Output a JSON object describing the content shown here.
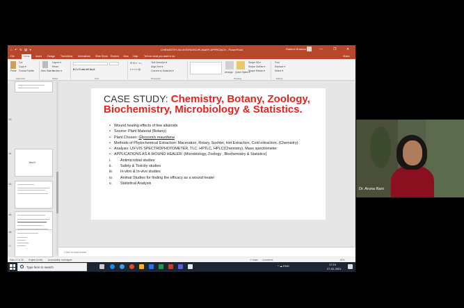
{
  "titlebar": {
    "quick_access": "⌂ ↶ ↻ ▤ ▾",
    "document_title": "CHEMISTRY AN INTERDISCIPLINARY APPROACH - PowerPoint",
    "user": "Rashmi Sharma",
    "minimize": "—",
    "restore": "❐",
    "close": "✕"
  },
  "menu": {
    "file": "File",
    "home": "Home",
    "insert": "Insert",
    "design": "Design",
    "transitions": "Transitions",
    "animations": "Animations",
    "slide_show": "Slide Show",
    "review": "Review",
    "view": "View",
    "help": "Help",
    "tell_me": "Tell me what you want to do",
    "share": "Share"
  },
  "ribbon": {
    "paste": "Paste",
    "cut": "Cut",
    "copy": "Copy ▾",
    "format_painter": "Format Painter",
    "clipboard": "Clipboard",
    "new_slide": "New Slide ▾",
    "layout": "Layout ▾",
    "reset": "Reset",
    "section": "Section ▾",
    "slides": "Slides",
    "font": "Font",
    "paragraph": "Paragraph",
    "text_direction": "Text Direction ▾",
    "align_text": "Align Text ▾",
    "convert_smartart": "Convert to SmartArt ▾",
    "arrange": "Arrange",
    "quick_styles": "Quick Styles ▾",
    "shape_fill": "Shape Fill ▾",
    "shape_outline": "Shape Outline ▾",
    "shape_effects": "Shape Effects ▾",
    "drawing": "Drawing",
    "find": "Find",
    "replace": "Replace ▾",
    "select": "Select ▾",
    "editing": "Editing"
  },
  "thumbnails": {
    "slide13_num": "13",
    "slide14_num": "14",
    "slide14_text": "Yes!!!",
    "slide15_num": "15",
    "slide16_num": "16",
    "slide17_num": "17",
    "slide18_num": "18"
  },
  "slide": {
    "title_prefix": "CASE STUDY:",
    "title_main": "Chemistry, Botany, Zoology, Biochemistry, Microbiology & Statistics.",
    "bullets": [
      "Wound healing effects of few alkaloids",
      "Source: Plant Material (Botany)",
      "Plant Chosen: ",
      "Methods of Phytochemical Extraction: Maceration, Rotary, Soxhlet, Hot Extraction, Cold extraction..(Chemistry)",
      "Analysis: UV-VIS SPECTROPHOTOMETER, TLC. HPTLC, HPLC(Chemistry), Mass spectrometer",
      "APPLICATIONS AS A WOUND HEALER: (Microbiology, Zoology , Biochemistry & Statistics)"
    ],
    "plant_name": "Glycosmis mauritiana",
    "sub_numbers": [
      "i.",
      "ii.",
      "iii.",
      "iv.",
      "v."
    ],
    "sub_items": [
      "Antimicrobial studies",
      "Safety & Toxicity studies",
      "In-vitro & In-vivo studies",
      "Animal Studies for finding the efficacy as a wound healer",
      "Statistical Analysis"
    ]
  },
  "notes_placeholder": "Click to add notes",
  "statusbar": {
    "slide_count": "Slide 17 of 30",
    "language": "English (India)",
    "accessibility": "Accessibility: Investigate",
    "notes": "≙ Notes",
    "comments": "Comments",
    "zoom": "61%"
  },
  "taskbar": {
    "search_placeholder": "Type here to search",
    "tray_text": "^ ☁ ENG",
    "time": "17:10",
    "date": "27-02-2021"
  },
  "webcam": {
    "name_label": "Dr. Aruna Rani"
  },
  "colors": {
    "ppt_accent": "#b7472a",
    "title_red": "#e8221c"
  }
}
